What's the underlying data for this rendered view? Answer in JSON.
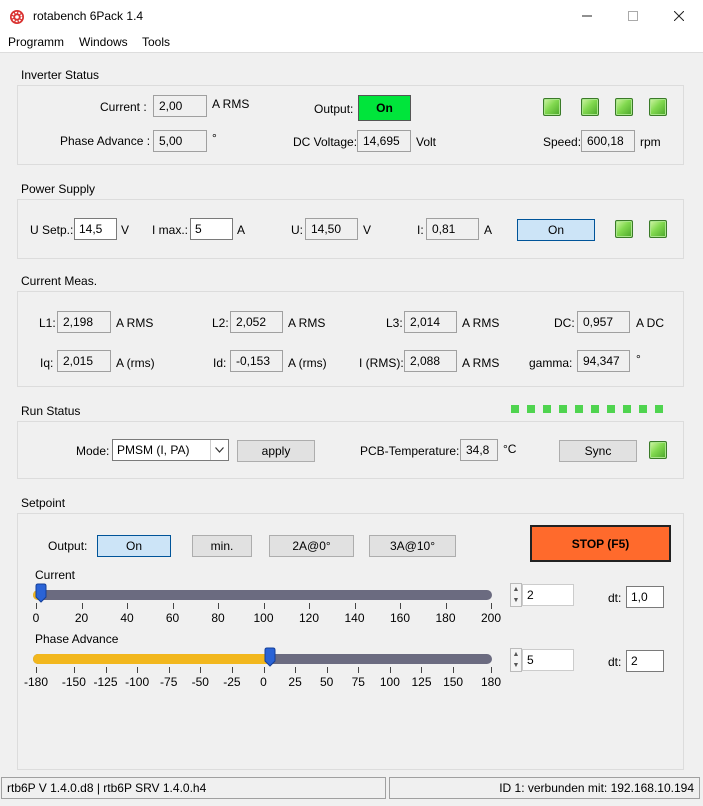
{
  "window": {
    "title": "rotabench 6Pack 1.4"
  },
  "menu": {
    "items": [
      "Programm",
      "Windows",
      "Tools"
    ]
  },
  "inverter_status": {
    "label": "Inverter Status",
    "current_label": "Current :",
    "current_value": "2,00",
    "current_unit": "A RMS",
    "phase_label": "Phase Advance :",
    "phase_value": "5,00",
    "phase_unit": "°",
    "output_label": "Output:",
    "output_value": "On",
    "dc_label": "DC Voltage:",
    "dc_value": "14,695",
    "dc_unit": "Volt",
    "speed_label": "Speed:",
    "speed_value": "600,18",
    "speed_unit": "rpm"
  },
  "power_supply": {
    "label": "Power Supply",
    "usetp_label": "U Setp.:",
    "usetp_value": "14,5",
    "usetp_unit": "V",
    "imax_label": "I max.:",
    "imax_value": "5",
    "imax_unit": "A",
    "u_label": "U:",
    "u_value": "14,50",
    "u_unit": "V",
    "i_label": "I:",
    "i_value": "0,81",
    "i_unit": "A",
    "on_button": "On"
  },
  "current_meas": {
    "label": "Current Meas.",
    "l1_label": "L1:",
    "l1_value": "2,198",
    "l1_unit": "A RMS",
    "l2_label": "L2:",
    "l2_value": "2,052",
    "l2_unit": "A RMS",
    "l3_label": "L3:",
    "l3_value": "2,014",
    "l3_unit": "A RMS",
    "dc_label": "DC:",
    "dc_value": "0,957",
    "dc_unit": "A DC",
    "iq_label": "Iq:",
    "iq_value": "2,015",
    "iq_unit": "A (rms)",
    "id_label": "Id:",
    "id_value": "-0,153",
    "id_unit": "A (rms)",
    "irms_label": "I (RMS):",
    "irms_value": "2,088",
    "irms_unit": "A RMS",
    "gamma_label": "gamma:",
    "gamma_value": "94,347",
    "gamma_unit": "°"
  },
  "run_status": {
    "label": "Run Status",
    "mode_label": "Mode:",
    "mode_value": "PMSM (I, PA)",
    "apply_button": "apply",
    "pcb_label": "PCB-Temperature:",
    "pcb_value": "34,8",
    "pcb_unit": "°C",
    "sync_button": "Sync"
  },
  "setpoint": {
    "label": "Setpoint",
    "output_label": "Output:",
    "buttons": [
      "On",
      "min.",
      "2A@0°",
      "3A@10°"
    ],
    "stop_button": "STOP (F5)",
    "current_label": "Current",
    "current_ticks": [
      "0",
      "20",
      "40",
      "60",
      "80",
      "100",
      "120",
      "140",
      "160",
      "180",
      "200"
    ],
    "current_value": "2",
    "current_dt_label": "dt:",
    "current_dt_value": "1,0",
    "current_slider_value": 2,
    "phase_label": "Phase Advance",
    "phase_ticks": [
      "-180",
      "-150",
      "-125",
      "-100",
      "-75",
      "-50",
      "-25",
      "0",
      "25",
      "50",
      "75",
      "100",
      "125",
      "150",
      "180"
    ],
    "phase_value": "5",
    "phase_dt_label": "dt:",
    "phase_dt_value": "2",
    "phase_slider_value": 5
  },
  "statusbar": {
    "left": "rtb6P V 1.4.0.d8 | rtb6P SRV 1.4.0.h4",
    "right": "ID 1: verbunden mit: 192.168.10.194"
  }
}
